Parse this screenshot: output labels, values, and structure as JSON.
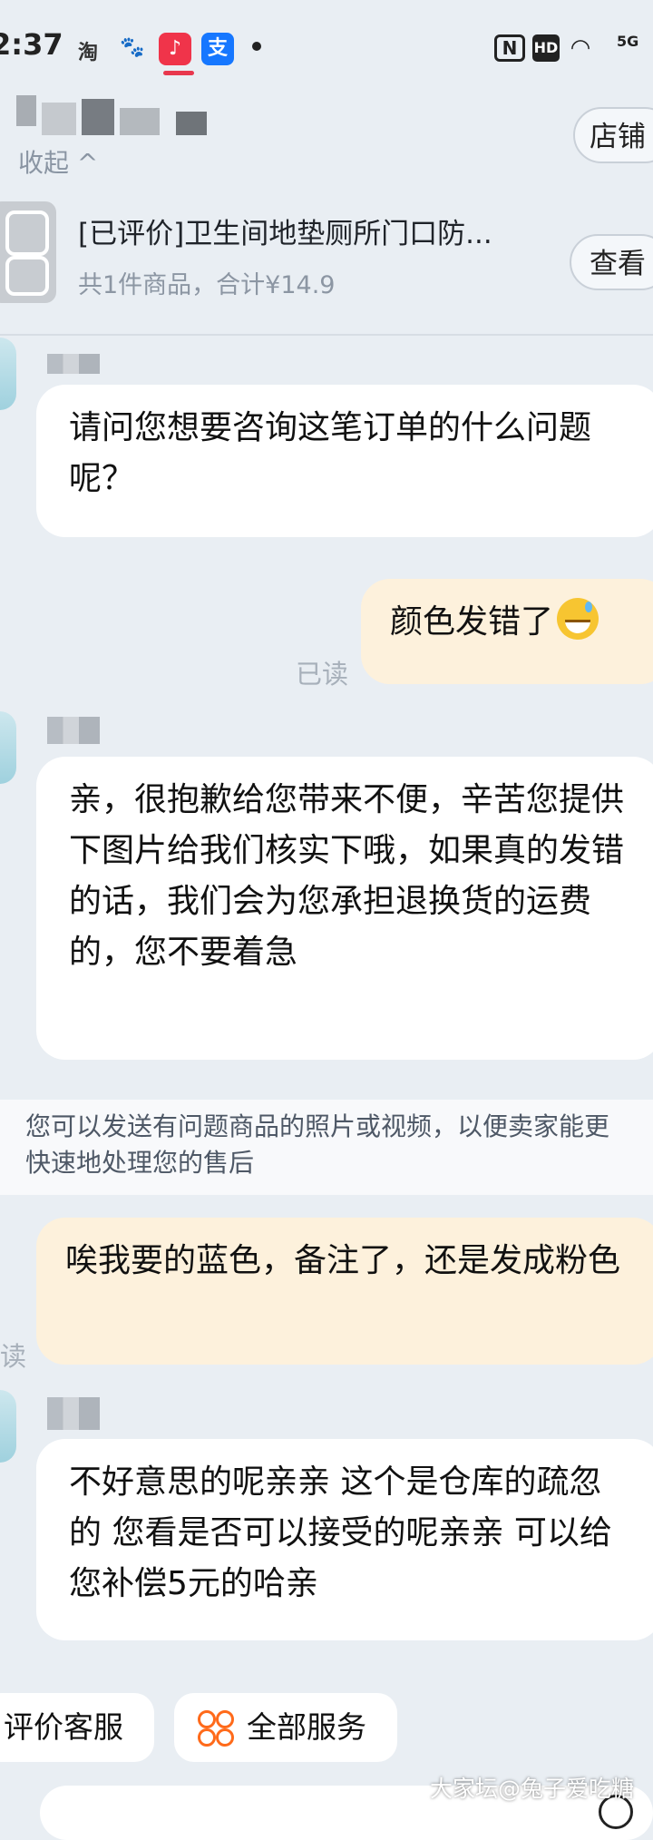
{
  "status_bar": {
    "time": "2:37",
    "apps": [
      "淘",
      "支"
    ],
    "signal": "5G"
  },
  "header": {
    "collapse_label": "收起 ^",
    "store_button": "店铺"
  },
  "order": {
    "title": "[已评价]卫生间地垫厕所门口防...",
    "summary": "共1件商品，合计¥14.9",
    "view_button": "查看"
  },
  "messages": [
    {
      "from": "shop",
      "text": "请问您想要咨询这笔订单的什么问题呢？"
    },
    {
      "from": "user",
      "text": "颜色发错了",
      "read": "已读"
    },
    {
      "from": "shop",
      "text": "亲，很抱歉给您带来不便，辛苦您提供下图片给我们核实下哦，如果真的发错的话，我们会为您承担退换货的运费的，您不要着急"
    },
    {
      "from": "system",
      "text": "您可以发送有问题商品的照片或视频，以便卖家能更快速地处理您的售后"
    },
    {
      "from": "user",
      "text": "唉我要的蓝色，备注了，还是发成粉色",
      "read": "读"
    },
    {
      "from": "shop",
      "text": "不好意思的呢亲亲 这个是仓库的疏忽的 您看是否可以接受的呢亲亲 可以给您补偿5元的哈亲"
    }
  ],
  "quick_actions": {
    "review_service": "评价客服",
    "all_services": "全部服务"
  },
  "watermark": "大家坛@兔子爱吃糖",
  "colors": {
    "page_bg": "#e9eef3",
    "user_bubble": "#fdf1dc",
    "shop_bubble": "#ffffff",
    "accent_orange": "#ff6a1a"
  },
  "icons": [
    "music-app-icon",
    "alipay-icon",
    "baidu-icon",
    "nfc-icon",
    "hd-icon",
    "wifi-icon",
    "grin-sweat-emoji",
    "all-services-grid-icon"
  ]
}
